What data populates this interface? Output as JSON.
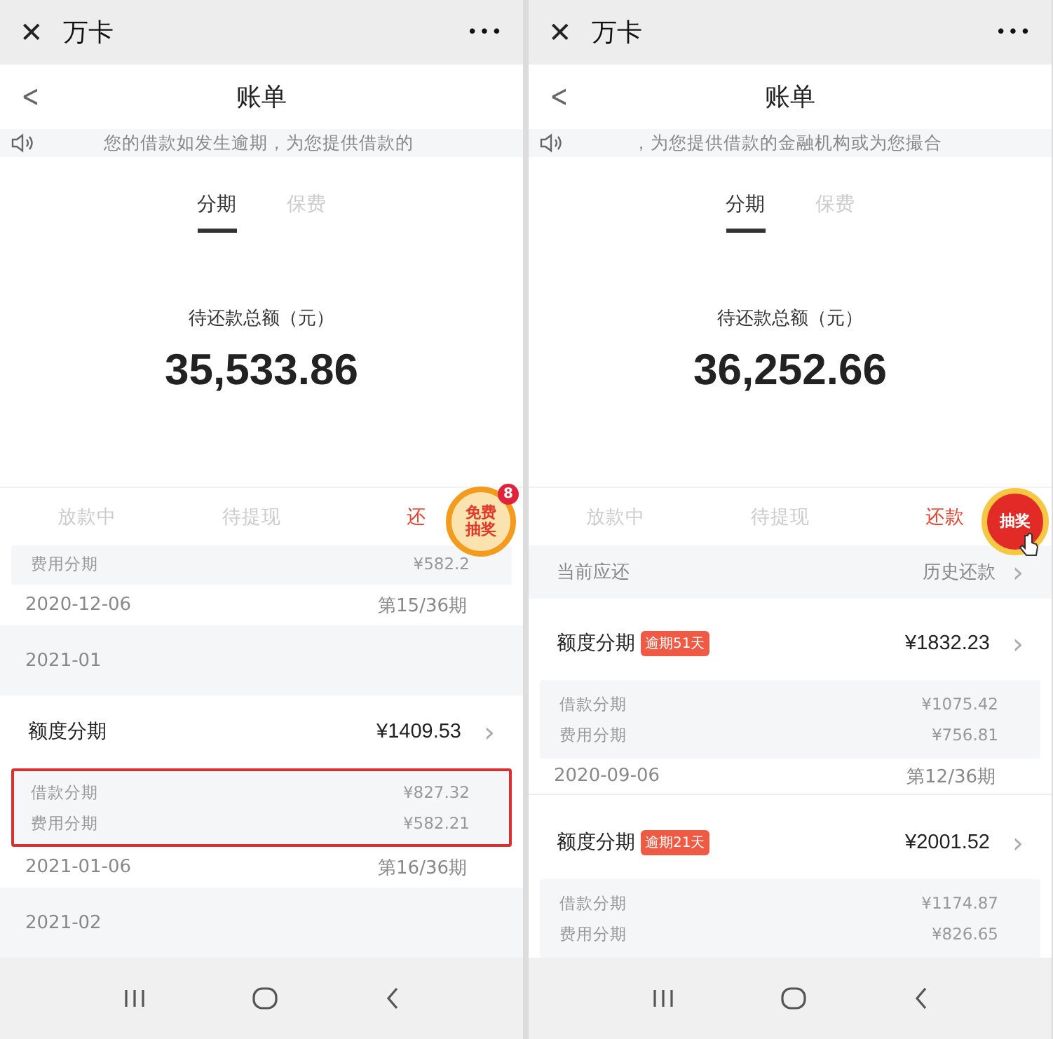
{
  "panels": [
    {
      "app_bar": {
        "close": "✕",
        "title": "万卡",
        "more": "•••"
      },
      "header": {
        "back": "<",
        "title": "账单"
      },
      "notice": {
        "text": "您的借款如发生逾期，为您提供借款的"
      },
      "tabs": [
        {
          "label": "分期",
          "selected": true
        },
        {
          "label": "保费",
          "selected": false
        }
      ],
      "total": {
        "label": "待还款总额（元）",
        "amount": "35,533.86"
      },
      "segments": [
        {
          "label": "放款中",
          "selected": false
        },
        {
          "label": "待提现",
          "selected": false
        },
        {
          "label": "还",
          "selected": true
        }
      ],
      "floating_badge": {
        "kind": "free",
        "lines": [
          "免费",
          "抽奖"
        ],
        "count": "8"
      },
      "list": [
        {
          "kind": "sub_group",
          "highlighted": false,
          "partial": true,
          "rows": [
            {
              "label": "费用分期",
              "value": "¥582.2"
            }
          ]
        },
        {
          "kind": "date",
          "date": "2020-12-06",
          "period": "第15/36期"
        },
        {
          "kind": "month",
          "label": "2021-01"
        },
        {
          "kind": "item",
          "label": "额度分期",
          "amount": "¥1409.53",
          "chevron": "›"
        },
        {
          "kind": "sub_group",
          "highlighted": true,
          "rows": [
            {
              "label": "借款分期",
              "value": "¥827.32"
            },
            {
              "label": "费用分期",
              "value": "¥582.21"
            }
          ]
        },
        {
          "kind": "date",
          "date": "2021-01-06",
          "period": "第16/36期"
        },
        {
          "kind": "month",
          "label": "2021-02"
        }
      ]
    },
    {
      "app_bar": {
        "close": "✕",
        "title": "万卡",
        "more": "•••"
      },
      "header": {
        "back": "<",
        "title": "账单"
      },
      "notice": {
        "text": "，为您提供借款的金融机构或为您撮合"
      },
      "tabs": [
        {
          "label": "分期",
          "selected": true
        },
        {
          "label": "保费",
          "selected": false
        }
      ],
      "total": {
        "label": "待还款总额（元）",
        "amount": "36,252.66"
      },
      "segments": [
        {
          "label": "放款中",
          "selected": false
        },
        {
          "label": "待提现",
          "selected": false
        },
        {
          "label": "还款",
          "selected": true
        }
      ],
      "floating_badge": {
        "kind": "lottery",
        "lines": [
          "抽奖"
        ]
      },
      "list": [
        {
          "kind": "current",
          "label": "当前应还",
          "link": "历史还款",
          "chevron": "›"
        },
        {
          "kind": "item",
          "label": "额度分期",
          "tag": "逾期51天",
          "amount": "¥1832.23",
          "chevron": "›"
        },
        {
          "kind": "sub_group",
          "highlighted": false,
          "rows": [
            {
              "label": "借款分期",
              "value": "¥1075.42"
            },
            {
              "label": "费用分期",
              "value": "¥756.81"
            }
          ]
        },
        {
          "kind": "date",
          "date": "2020-09-06",
          "period": "第12/36期",
          "divider": true
        },
        {
          "kind": "item",
          "label": "额度分期",
          "tag": "逾期21天",
          "amount": "¥2001.52",
          "chevron": "›"
        },
        {
          "kind": "sub_group",
          "highlighted": false,
          "rows": [
            {
              "label": "借款分期",
              "value": "¥1174.87"
            },
            {
              "label": "费用分期",
              "value": "¥826.65"
            }
          ]
        }
      ]
    }
  ]
}
